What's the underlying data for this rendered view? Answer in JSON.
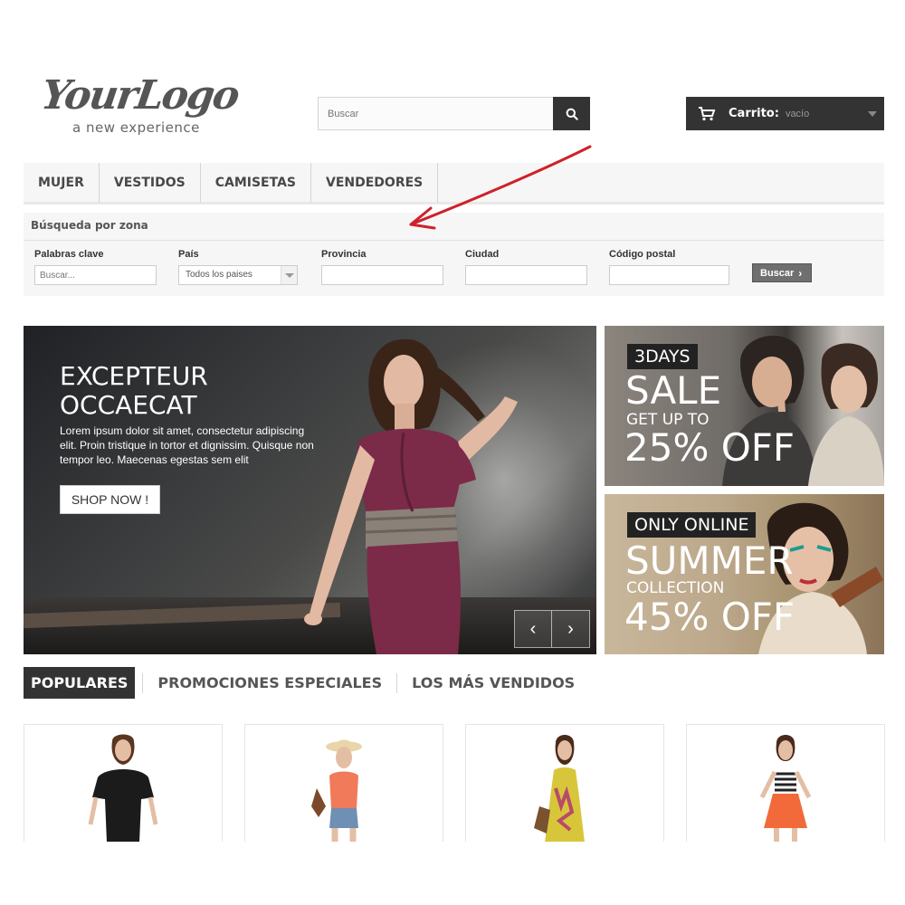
{
  "logo": {
    "main": "YourLogo",
    "tagline": "a new experience"
  },
  "search": {
    "placeholder": "Buscar"
  },
  "cart": {
    "label": "Carrito:",
    "status": "vacío"
  },
  "menu": {
    "items": [
      "MUJER",
      "VESTIDOS",
      "CAMISETAS",
      "VENDEDORES"
    ]
  },
  "zone_search": {
    "title": "Búsqueda por zona",
    "keywords_label": "Palabras clave",
    "keywords_placeholder": "Buscar...",
    "country_label": "País",
    "country_selected": "Todos los paises",
    "province_label": "Provincia",
    "city_label": "Ciudad",
    "postcode_label": "Código postal",
    "submit_label": "Buscar"
  },
  "hero": {
    "title_line1": "EXCEPTEUR",
    "title_line2": "OCCAECAT",
    "text": "Lorem ipsum dolor sit amet, consectetur adipiscing elit. Proin tristique in tortor et dignissim. Quisque non tempor leo. Maecenas egestas sem elit",
    "button_label": "SHOP NOW !",
    "prev": "‹",
    "next": "›"
  },
  "promos": [
    {
      "tag": "3DAYS",
      "big": "SALE",
      "small": "GET UP TO",
      "pct": "25% OFF"
    },
    {
      "tag": "ONLY ONLINE",
      "big": "SUMMER",
      "small": "COLLECTION",
      "pct": "45% OFF"
    }
  ],
  "tabs": [
    "POPULARES",
    "PROMOCIONES ESPECIALES",
    "LOS MÁS VENDIDOS"
  ],
  "colors": {
    "dark": "#333333",
    "accent_arrow": "#d0202a",
    "panel": "#f6f6f6"
  }
}
